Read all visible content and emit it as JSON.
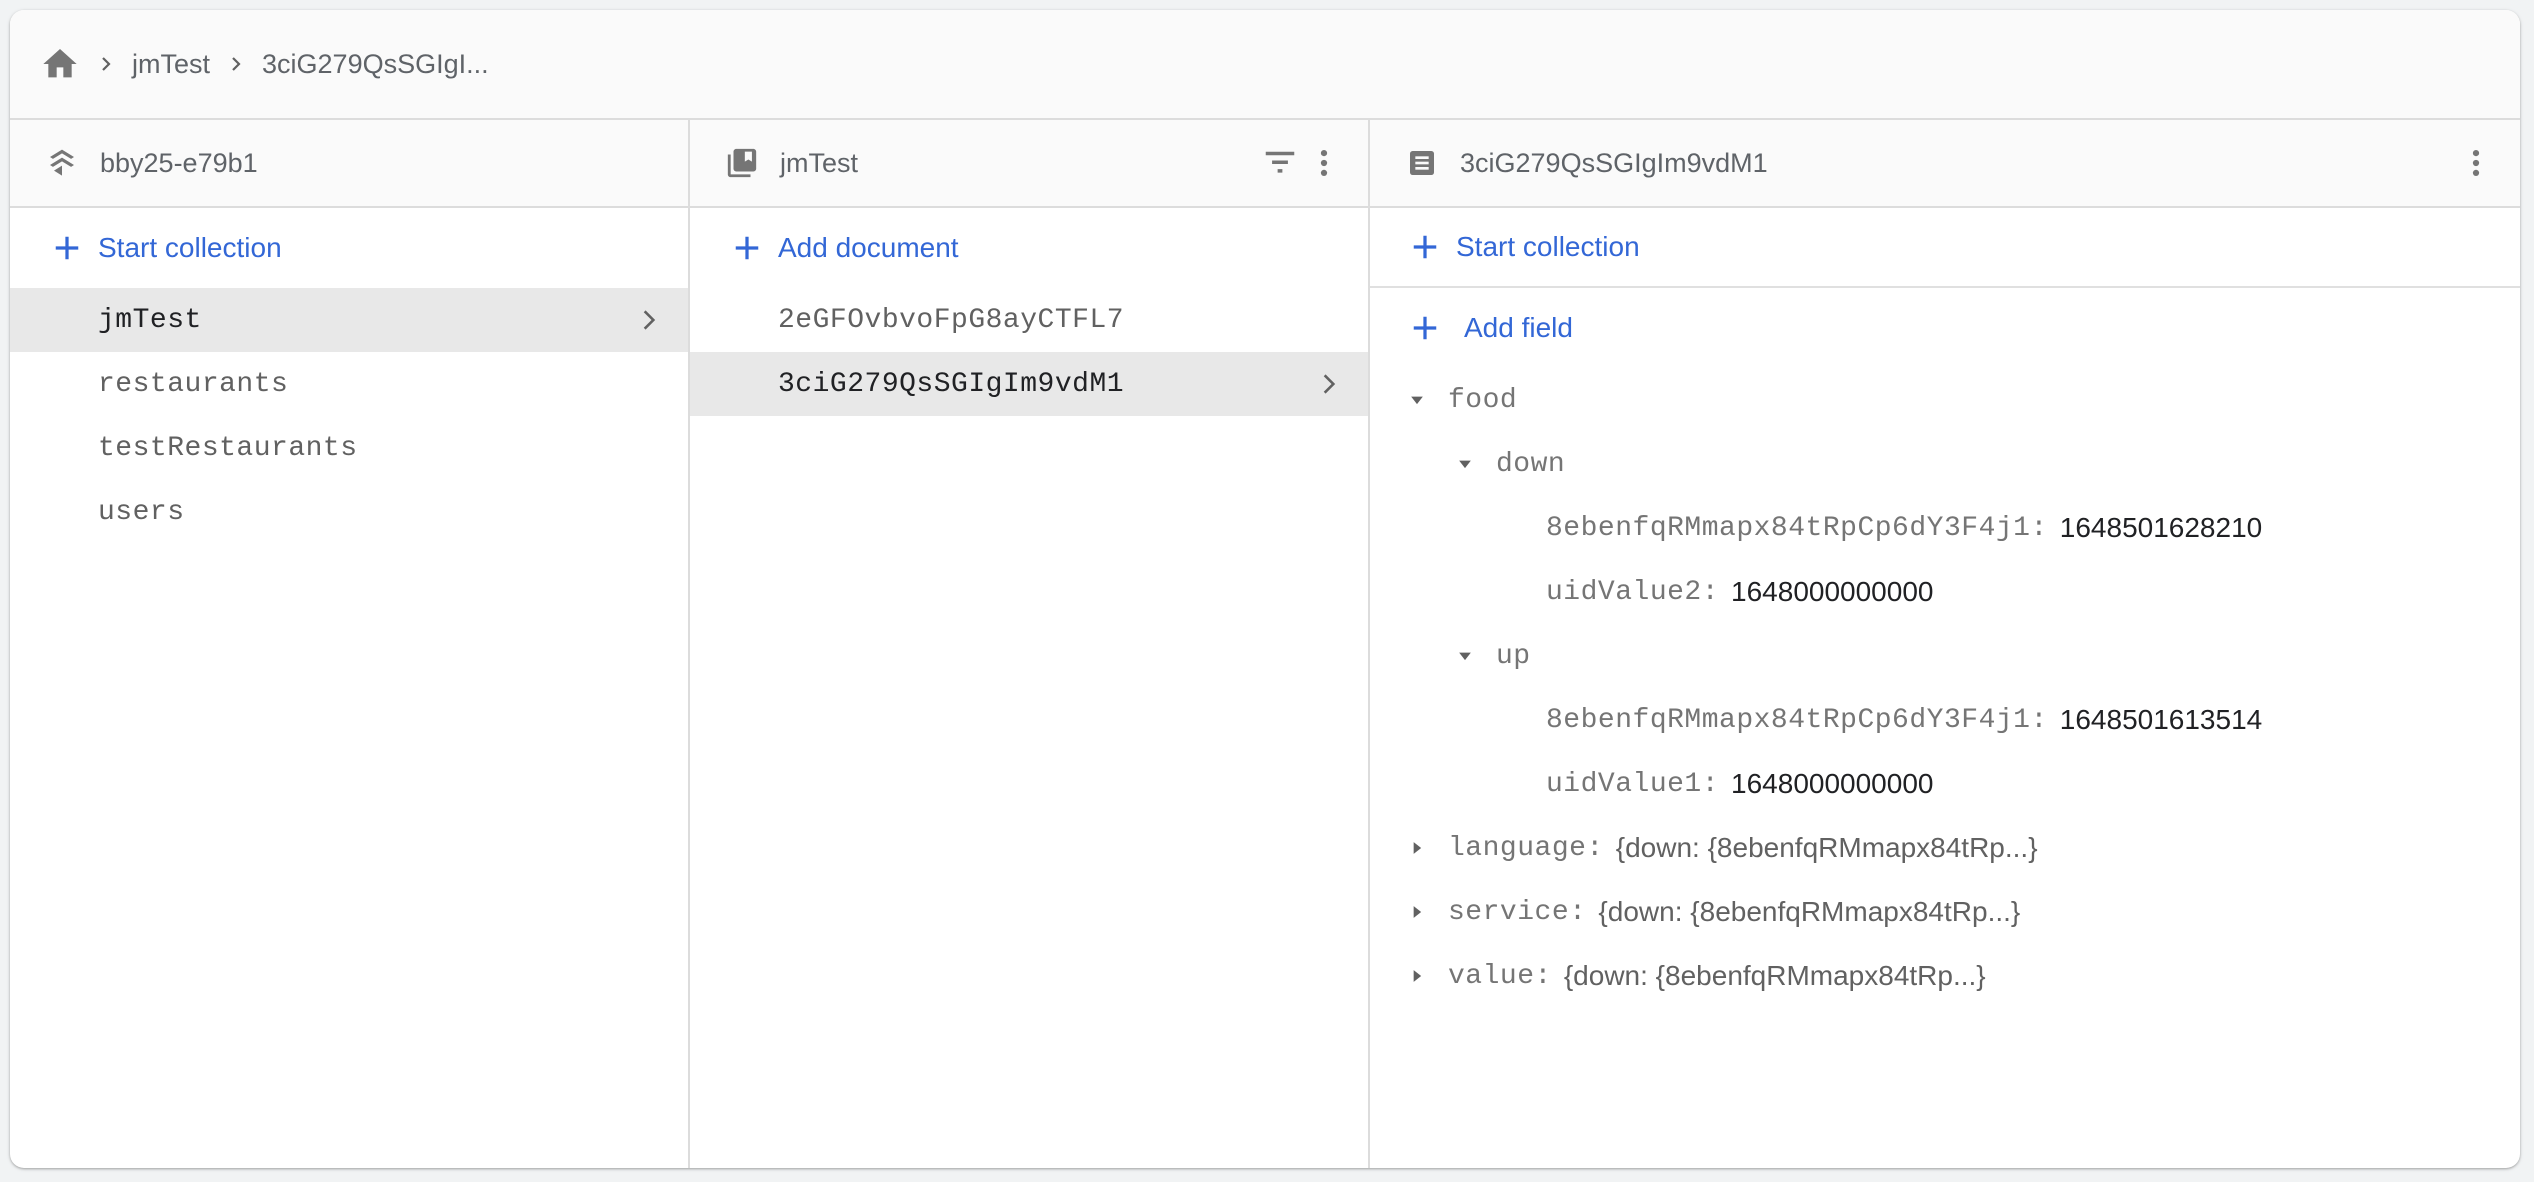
{
  "breadcrumb": {
    "items": [
      "jmTest",
      "3ciG279QsSGIgI..."
    ]
  },
  "root_panel": {
    "title": "bby25-e79b1",
    "action_label": "Start collection",
    "collections": [
      {
        "name": "jmTest",
        "selected": true
      },
      {
        "name": "restaurants",
        "selected": false
      },
      {
        "name": "testRestaurants",
        "selected": false
      },
      {
        "name": "users",
        "selected": false
      }
    ]
  },
  "collection_panel": {
    "title": "jmTest",
    "action_label": "Add document",
    "documents": [
      {
        "id": "2eGFOvbvoFpG8ayCTFL7",
        "selected": false
      },
      {
        "id": "3ciG279QsSGIgIm9vdM1",
        "selected": true
      }
    ]
  },
  "document_panel": {
    "title": "3ciG279QsSGIgIm9vdM1",
    "start_collection_label": "Start collection",
    "add_field_label": "Add field",
    "fields": {
      "food": {
        "key": "food",
        "down": {
          "key": "down",
          "entries": [
            {
              "key": "8ebenfqRMmapx84tRpCp6dY3F4j1:",
              "value": "1648501628210"
            },
            {
              "key": "uidValue2:",
              "value": "1648000000000"
            }
          ]
        },
        "up": {
          "key": "up",
          "entries": [
            {
              "key": "8ebenfqRMmapx84tRpCp6dY3F4j1:",
              "value": "1648501613514"
            },
            {
              "key": "uidValue1:",
              "value": "1648000000000"
            }
          ]
        }
      },
      "collapsed": [
        {
          "key": "language:",
          "summary": "{down: {8ebenfqRMmapx84tRp...}"
        },
        {
          "key": "service:",
          "summary": "{down: {8ebenfqRMmapx84tRp...}"
        },
        {
          "key": "value:",
          "summary": "{down: {8ebenfqRMmapx84tRp...}"
        }
      ]
    }
  },
  "colors": {
    "accent": "#3367d6",
    "icon": "#757575",
    "selected_bg": "#e8e8e8",
    "header_bg": "#fafafa"
  }
}
